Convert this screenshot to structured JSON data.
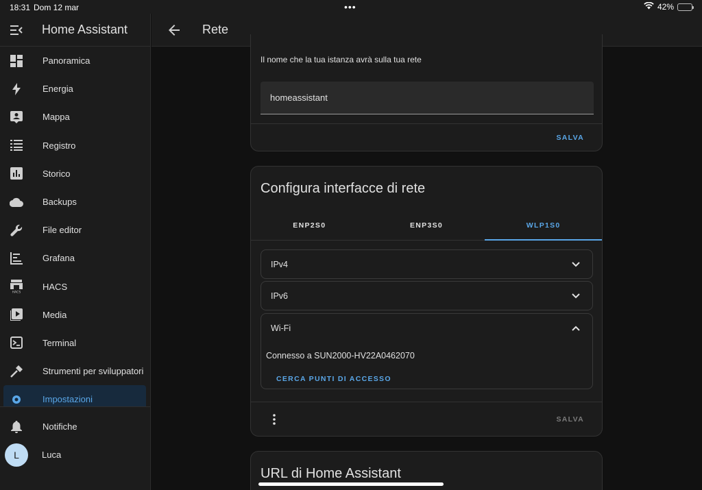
{
  "status_bar": {
    "time": "18:31",
    "date": "Dom 12 mar",
    "battery": "42%",
    "battery_level": 0.42
  },
  "sidebar": {
    "title": "Home Assistant",
    "items": [
      {
        "label": "Panoramica",
        "icon": "dashboard-icon"
      },
      {
        "label": "Energia",
        "icon": "lightning-icon"
      },
      {
        "label": "Mappa",
        "icon": "map-account-icon"
      },
      {
        "label": "Registro",
        "icon": "list-icon"
      },
      {
        "label": "Storico",
        "icon": "chart-box-icon"
      },
      {
        "label": "Backups",
        "icon": "cloud-icon"
      },
      {
        "label": "File editor",
        "icon": "wrench-icon"
      },
      {
        "label": "Grafana",
        "icon": "chart-timeline-icon"
      },
      {
        "label": "HACS",
        "icon": "hacs-icon"
      },
      {
        "label": "Media",
        "icon": "play-box-icon"
      },
      {
        "label": "Terminal",
        "icon": "console-icon"
      },
      {
        "label": "Strumenti per sviluppatori",
        "icon": "hammer-icon"
      },
      {
        "label": "Impostazioni",
        "icon": "cog-icon"
      }
    ],
    "notifications_label": "Notifiche",
    "user_initial": "L",
    "user_name": "Luca"
  },
  "header": {
    "title": "Rete"
  },
  "hostname_card": {
    "description": "Il nome che la tua istanza avrà sulla tua rete",
    "value": "homeassistant",
    "save_label": "SALVA"
  },
  "interfaces_card": {
    "title": "Configura interfacce di rete",
    "tabs": [
      {
        "label": "ENP2S0",
        "active": false
      },
      {
        "label": "ENP3S0",
        "active": false
      },
      {
        "label": "WLP1S0",
        "active": true
      }
    ],
    "ipv4_label": "IPv4",
    "ipv6_label": "IPv6",
    "wifi_label": "Wi-Fi",
    "wifi_status": "Connesso a SUN2000-HV22A0462070",
    "search_label": "CERCA PUNTI DI ACCESSO",
    "save_label": "SALVA"
  },
  "url_card": {
    "title": "URL di Home Assistant"
  },
  "colors": {
    "accent": "#5aa7e8",
    "background": "#111111",
    "surface": "#1c1c1c"
  }
}
